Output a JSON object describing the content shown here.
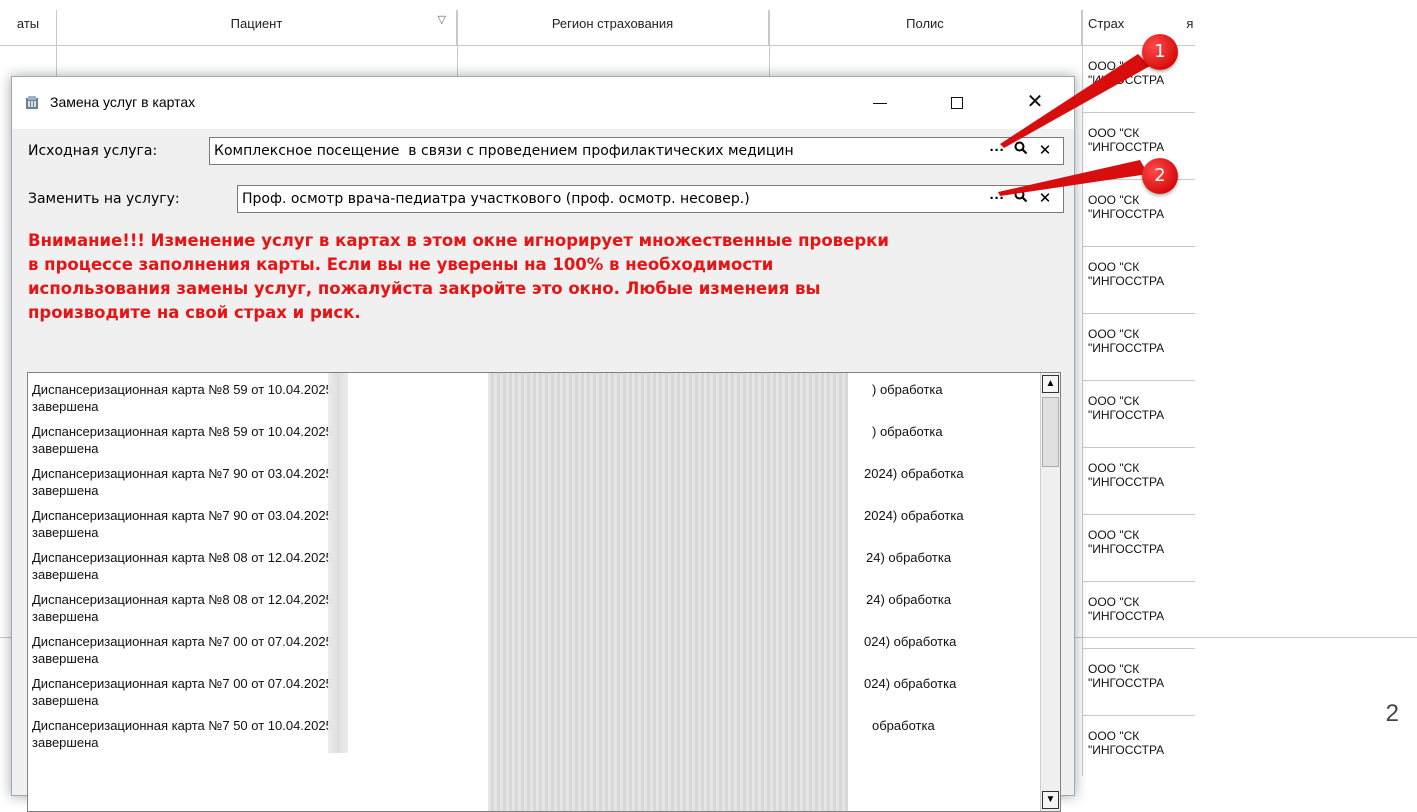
{
  "grid": {
    "columns": [
      {
        "label": "аты"
      },
      {
        "label": "Пациент"
      },
      {
        "label": "Регион страхования"
      },
      {
        "label": "Полис"
      },
      {
        "label": "Страх"
      },
      {
        "label": "я с"
      }
    ],
    "right_cells": [
      {
        "line1": "ООО \"СК",
        "line2": "\"ИНГОССТРА"
      },
      {
        "line1": "ООО \"СК",
        "line2": "\"ИНГОССТРА"
      },
      {
        "line1": "ООО \"СК",
        "line2": "\"ИНГОССТРА"
      },
      {
        "line1": "ООО \"СК",
        "line2": "\"ИНГОССТРА"
      },
      {
        "line1": "ООО \"СК",
        "line2": "\"ИНГОССТРА"
      },
      {
        "line1": "ООО \"СК",
        "line2": "\"ИНГОССТРА"
      },
      {
        "line1": "ООО \"СК",
        "line2": "\"ИНГОССТРА"
      },
      {
        "line1": "ООО \"СК",
        "line2": "\"ИНГОССТРА"
      },
      {
        "line1": "ООО \"СК",
        "line2": "\"ИНГОССТРА"
      },
      {
        "line1": "ООО \"СК",
        "line2": "\"ИНГОССТРА"
      },
      {
        "line1": "ООО \"СК",
        "line2": "\"ИНГОССТРА"
      }
    ]
  },
  "page_number": "2",
  "dialog": {
    "title": "Замена услуг в картах",
    "source_label": "Исходная услуга:",
    "source_value": "Комплексное посещение  в связи с проведением профилактических медицин",
    "replace_label": "Заменить на услугу:",
    "replace_value": "Проф. осмотр врача-педиатра участкового (проф. осмотр. несовер.)",
    "btn_more": "···",
    "warning_lines": [
      "Внимание!!! Изменение услуг в картах в этом окне игнорирует множественные проверки",
      "в процессе заполнения карты. Если вы не уверены на 100% в необходимости",
      "использования замены услуг, пожалуйста закройте это окно. Любые изменеия вы",
      "производите на свой страх и риск."
    ],
    "log_items": [
      {
        "text": "Диспансеризационная карта №8   59 от 10.04.2025",
        "tail": ") обработка",
        "cont": "завершена"
      },
      {
        "text": "Диспансеризационная карта №8   59 от 10.04.2025",
        "tail": ") обработка",
        "cont": "завершена"
      },
      {
        "text": "Диспансеризационная карта №7   90 от 03.04.2025",
        "tail": "2024) обработка",
        "cont": "завершена"
      },
      {
        "text": "Диспансеризационная карта №7   90 от 03.04.2025",
        "tail": "2024) обработка",
        "cont": "завершена"
      },
      {
        "text": "Диспансеризационная карта №8   08 от 12.04.2025",
        "tail": "24) обработка",
        "cont": "завершена"
      },
      {
        "text": "Диспансеризационная карта №8   08 от 12.04.2025",
        "tail": "24) обработка",
        "cont": "завершена"
      },
      {
        "text": "Диспансеризационная карта №7   00 от 07.04.2025",
        "tail": "024) обработка",
        "cont": "завершена"
      },
      {
        "text": "Диспансеризационная карта №7   00 от 07.04.2025",
        "tail": "024) обработка",
        "cont": "завершена"
      },
      {
        "text": "Диспансеризационная карта №7   50 от 10.04.2025",
        "tail": " обработка",
        "cont": "завершена"
      }
    ]
  },
  "callouts": [
    "1",
    "2"
  ],
  "colors": {
    "warning": "#e81414",
    "callout": "#d80e0e"
  }
}
